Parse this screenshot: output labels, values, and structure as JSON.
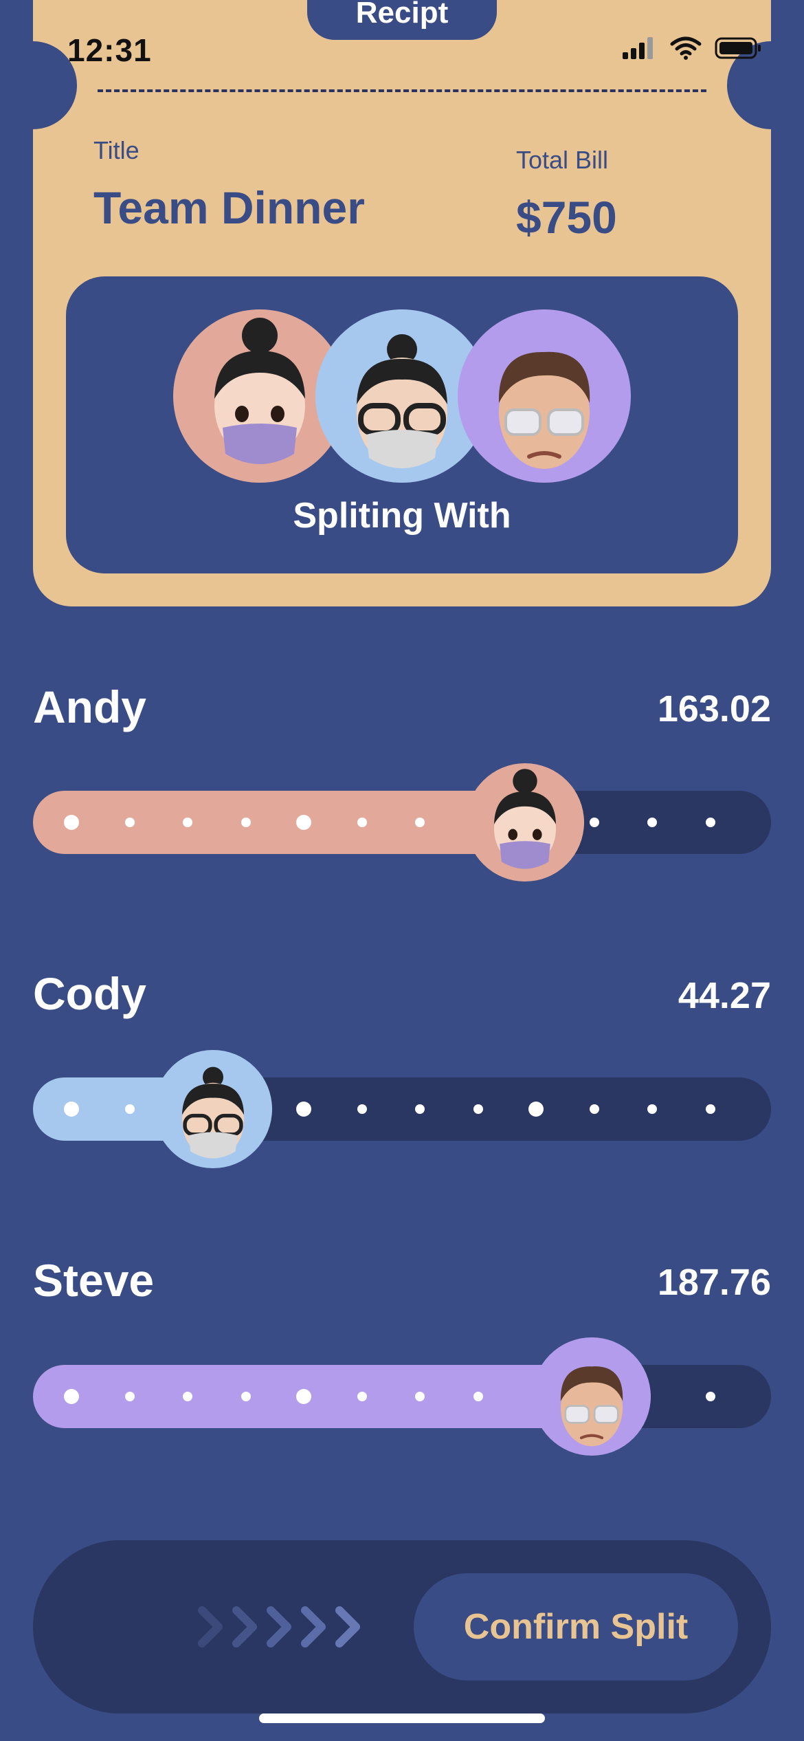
{
  "status_bar": {
    "time": "12:31"
  },
  "receipt": {
    "tab_label": "Recipt",
    "title_label": "Title",
    "title_value": "Team Dinner",
    "total_label": "Total Bill",
    "total_value": "$750",
    "split_label": "Spliting With"
  },
  "people": [
    {
      "name": "Andy",
      "amount": "163.02",
      "color": "#e2a99a",
      "avatar": "woman-bun-mask-avatar",
      "slider_fraction": 0.667
    },
    {
      "name": "Cody",
      "amount": "44.27",
      "color": "#a7c8ee",
      "avatar": "man-glasses-mask-avatar",
      "slider_fraction": 0.244
    },
    {
      "name": "Steve",
      "amount": "187.76",
      "color": "#b39cec",
      "avatar": "man-glasses-avatar",
      "slider_fraction": 0.757
    }
  ],
  "confirm": {
    "label": "Confirm Split"
  },
  "colors": {
    "background": "#3a4c85",
    "card": "#e8c493",
    "track": "#2a3762",
    "accent_text": "#e8c493"
  }
}
